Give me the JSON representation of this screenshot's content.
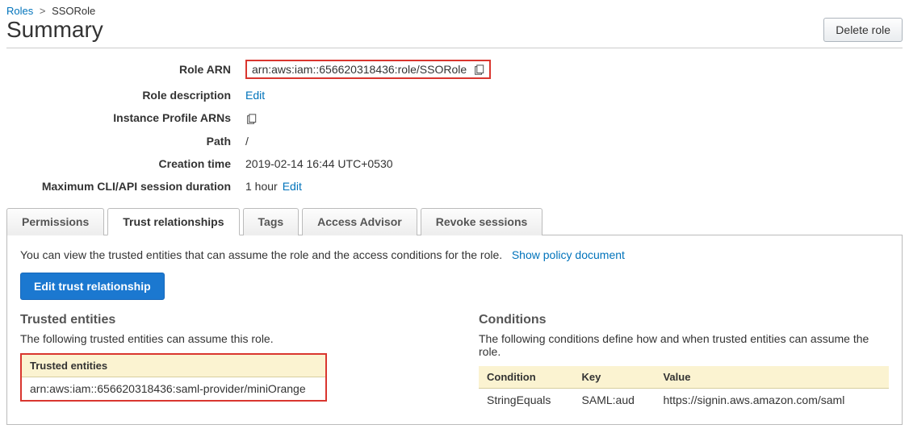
{
  "breadcrumb": {
    "roles": "Roles",
    "current": "SSORole"
  },
  "header": {
    "title": "Summary",
    "delete_btn": "Delete role"
  },
  "details": {
    "role_arn_label": "Role ARN",
    "role_arn_value": "arn:aws:iam::656620318436:role/SSORole",
    "role_desc_label": "Role description",
    "role_desc_edit": "Edit",
    "instance_profile_label": "Instance Profile ARNs",
    "path_label": "Path",
    "path_value": "/",
    "creation_label": "Creation time",
    "creation_value": "2019-02-14 16:44 UTC+0530",
    "max_session_label": "Maximum CLI/API session duration",
    "max_session_value": "1 hour",
    "max_session_edit": "Edit"
  },
  "tabs": {
    "permissions": "Permissions",
    "trust": "Trust relationships",
    "tags": "Tags",
    "advisor": "Access Advisor",
    "revoke": "Revoke sessions"
  },
  "trust_tab": {
    "desc": "You can view the trusted entities that can assume the role and the access conditions for the role.",
    "show_policy": "Show policy document",
    "edit_btn": "Edit trust relationship",
    "trusted_heading": "Trusted entities",
    "trusted_sub": "The following trusted entities can assume this role.",
    "trusted_col": "Trusted entities",
    "trusted_value": "arn:aws:iam::656620318436:saml-provider/miniOrange",
    "cond_heading": "Conditions",
    "cond_sub": "The following conditions define how and when trusted entities can assume the role.",
    "cond_cols": {
      "c1": "Condition",
      "c2": "Key",
      "c3": "Value"
    },
    "cond_row": {
      "c1": "StringEquals",
      "c2": "SAML:aud",
      "c3": "https://signin.aws.amazon.com/saml"
    }
  }
}
